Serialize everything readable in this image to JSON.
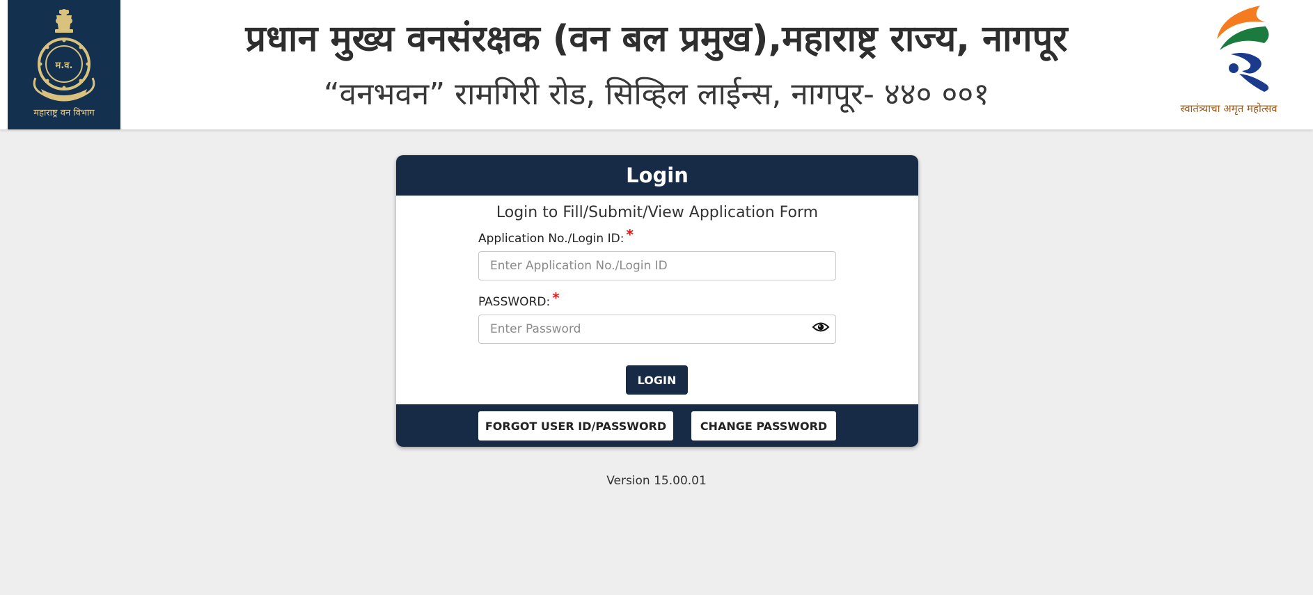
{
  "header": {
    "emblem_caption": "महाराष्ट्र वन विभाग",
    "title": "प्रधान मुख्य वनसंरक्षक (वन बल प्रमुख),महाराष्ट्र राज्य, नागपूर",
    "subtitle": "“वनभवन” रामगिरी रोड, सिव्हिल लाईन्स, नागपूर- ४४० ००१",
    "azadi_caption": "स्वातंत्र्याचा अमृत महोत्सव"
  },
  "login": {
    "heading": "Login",
    "subheading": "Login to Fill/Submit/View Application Form",
    "login_id_label": "Application No./Login ID:",
    "login_id_placeholder": "Enter Application No./Login ID",
    "password_label": "PASSWORD:",
    "password_placeholder": "Enter Password",
    "required_mark": "*",
    "login_button": "LOGIN",
    "forgot_button": "FORGOT USER ID/PASSWORD",
    "change_password_button": "CHANGE PASSWORD"
  },
  "version": "Version 15.00.01",
  "icons": {
    "emblem": "maharashtra-forest-emblem",
    "azadi": "azadi-ka-amrit-mahotsav-logo",
    "password_toggle": "eye-icon"
  },
  "colors": {
    "navy": "#172a46",
    "emblem_bg": "#13304f",
    "page_bg": "#eeeeee",
    "required": "#e01b1b"
  }
}
